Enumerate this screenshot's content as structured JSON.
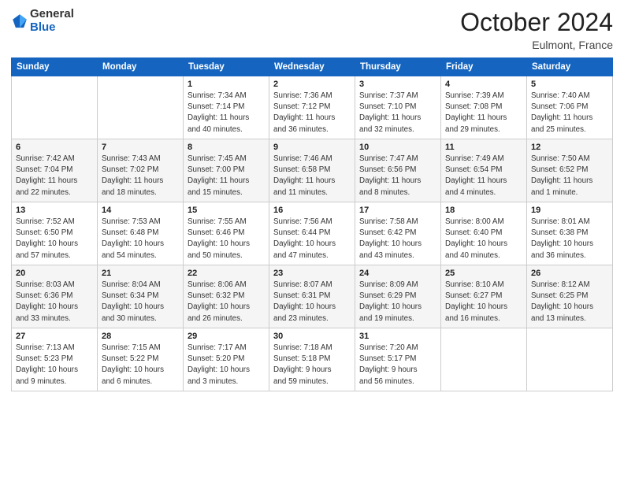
{
  "logo": {
    "general": "General",
    "blue": "Blue"
  },
  "title": "October 2024",
  "location": "Eulmont, France",
  "days_header": [
    "Sunday",
    "Monday",
    "Tuesday",
    "Wednesday",
    "Thursday",
    "Friday",
    "Saturday"
  ],
  "weeks": [
    [
      {
        "day": "",
        "info": ""
      },
      {
        "day": "",
        "info": ""
      },
      {
        "day": "1",
        "info": "Sunrise: 7:34 AM\nSunset: 7:14 PM\nDaylight: 11 hours\nand 40 minutes."
      },
      {
        "day": "2",
        "info": "Sunrise: 7:36 AM\nSunset: 7:12 PM\nDaylight: 11 hours\nand 36 minutes."
      },
      {
        "day": "3",
        "info": "Sunrise: 7:37 AM\nSunset: 7:10 PM\nDaylight: 11 hours\nand 32 minutes."
      },
      {
        "day": "4",
        "info": "Sunrise: 7:39 AM\nSunset: 7:08 PM\nDaylight: 11 hours\nand 29 minutes."
      },
      {
        "day": "5",
        "info": "Sunrise: 7:40 AM\nSunset: 7:06 PM\nDaylight: 11 hours\nand 25 minutes."
      }
    ],
    [
      {
        "day": "6",
        "info": "Sunrise: 7:42 AM\nSunset: 7:04 PM\nDaylight: 11 hours\nand 22 minutes."
      },
      {
        "day": "7",
        "info": "Sunrise: 7:43 AM\nSunset: 7:02 PM\nDaylight: 11 hours\nand 18 minutes."
      },
      {
        "day": "8",
        "info": "Sunrise: 7:45 AM\nSunset: 7:00 PM\nDaylight: 11 hours\nand 15 minutes."
      },
      {
        "day": "9",
        "info": "Sunrise: 7:46 AM\nSunset: 6:58 PM\nDaylight: 11 hours\nand 11 minutes."
      },
      {
        "day": "10",
        "info": "Sunrise: 7:47 AM\nSunset: 6:56 PM\nDaylight: 11 hours\nand 8 minutes."
      },
      {
        "day": "11",
        "info": "Sunrise: 7:49 AM\nSunset: 6:54 PM\nDaylight: 11 hours\nand 4 minutes."
      },
      {
        "day": "12",
        "info": "Sunrise: 7:50 AM\nSunset: 6:52 PM\nDaylight: 11 hours\nand 1 minute."
      }
    ],
    [
      {
        "day": "13",
        "info": "Sunrise: 7:52 AM\nSunset: 6:50 PM\nDaylight: 10 hours\nand 57 minutes."
      },
      {
        "day": "14",
        "info": "Sunrise: 7:53 AM\nSunset: 6:48 PM\nDaylight: 10 hours\nand 54 minutes."
      },
      {
        "day": "15",
        "info": "Sunrise: 7:55 AM\nSunset: 6:46 PM\nDaylight: 10 hours\nand 50 minutes."
      },
      {
        "day": "16",
        "info": "Sunrise: 7:56 AM\nSunset: 6:44 PM\nDaylight: 10 hours\nand 47 minutes."
      },
      {
        "day": "17",
        "info": "Sunrise: 7:58 AM\nSunset: 6:42 PM\nDaylight: 10 hours\nand 43 minutes."
      },
      {
        "day": "18",
        "info": "Sunrise: 8:00 AM\nSunset: 6:40 PM\nDaylight: 10 hours\nand 40 minutes."
      },
      {
        "day": "19",
        "info": "Sunrise: 8:01 AM\nSunset: 6:38 PM\nDaylight: 10 hours\nand 36 minutes."
      }
    ],
    [
      {
        "day": "20",
        "info": "Sunrise: 8:03 AM\nSunset: 6:36 PM\nDaylight: 10 hours\nand 33 minutes."
      },
      {
        "day": "21",
        "info": "Sunrise: 8:04 AM\nSunset: 6:34 PM\nDaylight: 10 hours\nand 30 minutes."
      },
      {
        "day": "22",
        "info": "Sunrise: 8:06 AM\nSunset: 6:32 PM\nDaylight: 10 hours\nand 26 minutes."
      },
      {
        "day": "23",
        "info": "Sunrise: 8:07 AM\nSunset: 6:31 PM\nDaylight: 10 hours\nand 23 minutes."
      },
      {
        "day": "24",
        "info": "Sunrise: 8:09 AM\nSunset: 6:29 PM\nDaylight: 10 hours\nand 19 minutes."
      },
      {
        "day": "25",
        "info": "Sunrise: 8:10 AM\nSunset: 6:27 PM\nDaylight: 10 hours\nand 16 minutes."
      },
      {
        "day": "26",
        "info": "Sunrise: 8:12 AM\nSunset: 6:25 PM\nDaylight: 10 hours\nand 13 minutes."
      }
    ],
    [
      {
        "day": "27",
        "info": "Sunrise: 7:13 AM\nSunset: 5:23 PM\nDaylight: 10 hours\nand 9 minutes."
      },
      {
        "day": "28",
        "info": "Sunrise: 7:15 AM\nSunset: 5:22 PM\nDaylight: 10 hours\nand 6 minutes."
      },
      {
        "day": "29",
        "info": "Sunrise: 7:17 AM\nSunset: 5:20 PM\nDaylight: 10 hours\nand 3 minutes."
      },
      {
        "day": "30",
        "info": "Sunrise: 7:18 AM\nSunset: 5:18 PM\nDaylight: 9 hours\nand 59 minutes."
      },
      {
        "day": "31",
        "info": "Sunrise: 7:20 AM\nSunset: 5:17 PM\nDaylight: 9 hours\nand 56 minutes."
      },
      {
        "day": "",
        "info": ""
      },
      {
        "day": "",
        "info": ""
      }
    ]
  ]
}
